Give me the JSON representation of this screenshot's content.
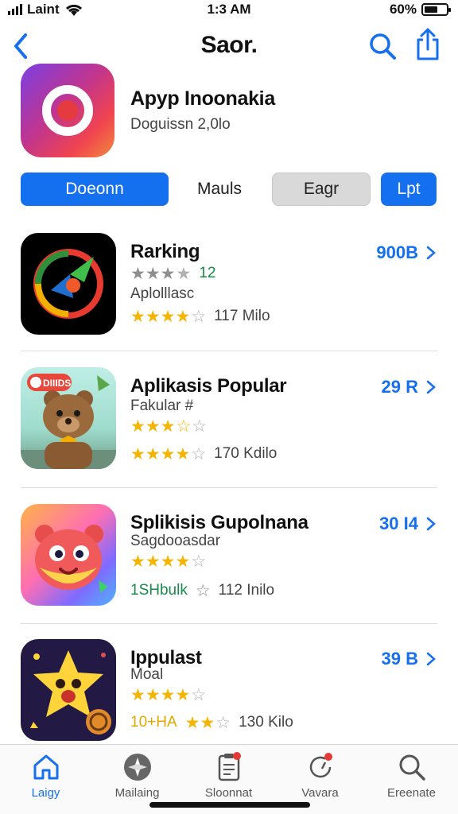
{
  "status": {
    "carrier": "Laint",
    "time": "1:3 AM",
    "battery": "60%"
  },
  "nav": {
    "title": "Saor."
  },
  "featured": {
    "title": "Apyp Inoonakia",
    "subtitle": "Doguissn 2,0lo"
  },
  "segments": [
    "Doeonn",
    "Mauls",
    "Eagr",
    "Lpt"
  ],
  "apps": [
    {
      "name": "Rarking",
      "size": "900B",
      "line1_text": "12",
      "line2_text": "Aplolllasc",
      "downloads": "117 Milo",
      "icon": "music-disc-icon"
    },
    {
      "name": "Aplikasis Popular",
      "size": "29 R",
      "line1_text": "Fakular #",
      "downloads": "170 Kdilo",
      "icon": "bear-icon",
      "icon_badge": "DIIIDS"
    },
    {
      "name": "Splikisis Gupolnana",
      "size": "30 I4",
      "line1_text": "Sagdooasdar",
      "line3_prefix": "1SHbulk",
      "downloads": "112 Inilo",
      "icon": "monster-icon"
    },
    {
      "name": "Ippulast",
      "size": "39 B",
      "line1_text": "Moal",
      "line3_prefix": "10+HA",
      "downloads": "130 Kilo",
      "icon": "star-character-icon"
    }
  ],
  "tabs": [
    {
      "label": "Laigy",
      "icon": "home-icon",
      "active": true
    },
    {
      "label": "Mailaing",
      "icon": "compass-icon",
      "active": false
    },
    {
      "label": "Sloonnat",
      "icon": "clipboard-icon",
      "active": false
    },
    {
      "label": "Vavara",
      "icon": "refresh-icon",
      "active": false
    },
    {
      "label": "Ereenate",
      "icon": "search-icon",
      "active": false
    }
  ],
  "colors": {
    "accent": "#1570ef",
    "star": "#f4b400"
  }
}
